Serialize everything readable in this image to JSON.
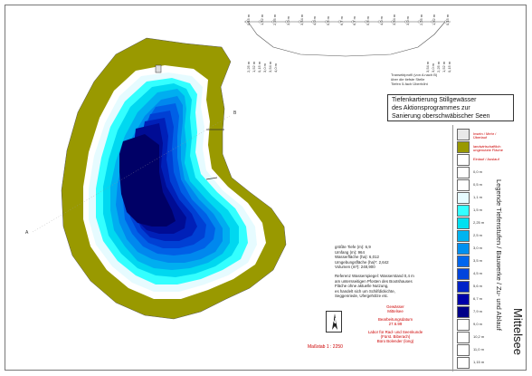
{
  "profile": {
    "caption_line1": "Transektprofil (von A nach B)",
    "caption_line2": "über die tiefste Stelle",
    "caption_line3": "Tiefen 5-fach Überhöht",
    "top_labels": [
      "0,15 m",
      "1,52 m",
      "2,25 m",
      "3,0 m",
      "3,54 m",
      "4,0 m",
      "5,6 m",
      "6,7 m",
      "6,7 m",
      "5,6 m",
      "4,0 m",
      "3,54 m",
      "3,0 m",
      "2,25 m",
      "1,52 m",
      "0,15 m"
    ],
    "bottom_labels_left": [
      "2,25 m",
      "1,52 m",
      "0,15 m",
      "3,0 m",
      "3,54 m",
      "4,0 m"
    ],
    "bottom_labels_right": [
      "3,54 m",
      "3,0 m",
      "2,25 m",
      "1,52 m",
      "0,15 m"
    ]
  },
  "title_box": {
    "line1": "Tiefenkartierung Stillgewässer",
    "line2": "des Aktionsprogrammes zur",
    "line3": "Sanierung oberschwäbischer Seen"
  },
  "map": {
    "label_a": "A",
    "label_b": "B",
    "north_letter": "N",
    "scale_text": "Maßstab 1 : 2250"
  },
  "stats": {
    "line1": "größte Tiefe (m): 6,9",
    "line2": "Umfang (m): 964",
    "line3": "Wasserfläche (ha): 6,012",
    "line4": "Umgebungsfläche (ha)*: 2,642",
    "line5": "Volumen (m³): 248,900",
    "note1": "Referenz Wasserspiegel: Wasserstand 0,4 m",
    "note2": "am untersseitigen Pfosten des Bootshauses",
    "note3": "Fläche ohne aktuelle Nutzung,",
    "note4": "es handelt sich um Schilfdickichte,",
    "note5": "Seggenriede, Ufergehölze etc.",
    "gewaesser_label": "Gewässer",
    "gewaesser_name": "Mittelsee",
    "datum_label": "Bearbeitungsdatum",
    "datum_value": "27.6.99",
    "labor1": "Labor für Rad- und Seenkunde",
    "labor2": "(Fürst. Biberach)",
    "labor3": "Büro Bolender (long)"
  },
  "legend": {
    "title": "Legende Tiefenstufen / Bauwerke / Zu- und Ablauf",
    "lake_name": "Mittelsee",
    "items": [
      {
        "label": "Inseln / Mehr / Überlauf",
        "color": "#e8e8e8"
      },
      {
        "label": "landwirtschaftlich ungenutzte Fläche",
        "color": "#999900"
      },
      {
        "label": "Einlauf / Auslauf",
        "color": "#ffffff"
      },
      {
        "label": "0,0 m",
        "color": "#ffffff"
      },
      {
        "label": "0,5 m",
        "color": "#ffffff"
      },
      {
        "label": "1,1 m",
        "color": "#e6fbff"
      },
      {
        "label": "1,5 m",
        "color": "#33ffff"
      },
      {
        "label": "2,25 m",
        "color": "#00e0f0"
      },
      {
        "label": "2,5 m",
        "color": "#00b4f0"
      },
      {
        "label": "3,0 m",
        "color": "#0090f0"
      },
      {
        "label": "3,5 m",
        "color": "#0066ee"
      },
      {
        "label": "4,5 m",
        "color": "#0044dd"
      },
      {
        "label": "5,6 m",
        "color": "#0022c8"
      },
      {
        "label": "6,7 m",
        "color": "#0000aa"
      },
      {
        "label": "7,9 m",
        "color": "#000088"
      },
      {
        "label": "9,0 m",
        "color": "#ffffff"
      },
      {
        "label": "10,2 m",
        "color": "#ffffff"
      },
      {
        "label": "11,0 m",
        "color": "#ffffff"
      },
      {
        "label": "1,15 m",
        "color": "#ffffff"
      }
    ]
  },
  "colors": {
    "land": "#999900",
    "shore": "#ffffff",
    "d1": "#e6fbff",
    "d2": "#33ffff",
    "d3": "#00d8f0",
    "d4": "#00aef0",
    "d5": "#0088ee",
    "d6": "#0060e6",
    "d7": "#0040d4",
    "d8": "#0020b8",
    "d9": "#000c94",
    "d10": "#000066",
    "red": "#cc0000"
  }
}
